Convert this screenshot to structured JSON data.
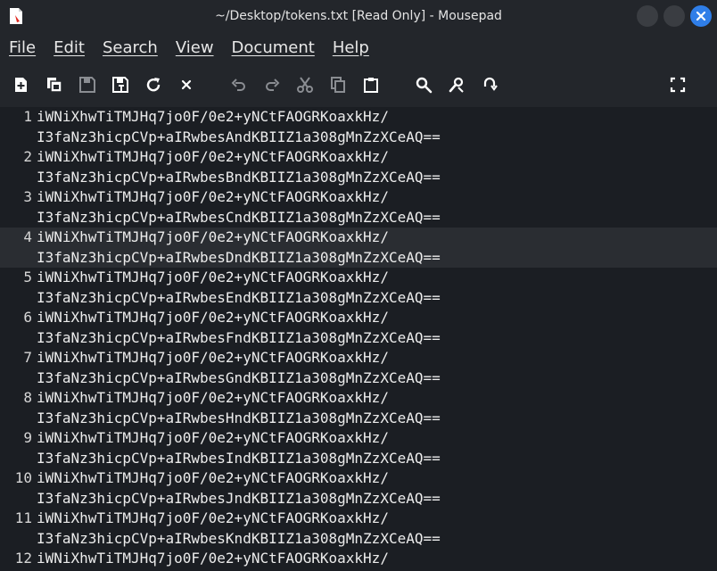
{
  "window": {
    "title": "~/Desktop/tokens.txt [Read Only] - Mousepad"
  },
  "menu": [
    {
      "id": "file",
      "label": "File"
    },
    {
      "id": "edit",
      "label": "Edit"
    },
    {
      "id": "search",
      "label": "Search"
    },
    {
      "id": "view",
      "label": "View"
    },
    {
      "id": "document",
      "label": "Document"
    },
    {
      "id": "help",
      "label": "Help"
    }
  ],
  "toolbar": {
    "icons": [
      "new-document-icon",
      "new-window-icon",
      "save-icon",
      "save-as-icon",
      "reload-icon",
      "close-tab-icon",
      "undo-icon",
      "redo-icon",
      "cut-icon",
      "copy-icon",
      "paste-icon",
      "find-icon",
      "find-replace-icon",
      "go-to-icon",
      "fullscreen-icon"
    ]
  },
  "editor": {
    "current_line": 4,
    "lines": [
      {
        "number": "1",
        "part1": "iWNiXhwTiTMJHq7jo0F/0e2+yNCtFAOGRKoaxkHz/",
        "part2": "I3faNz3hicpCVp+aIRwbesAndKBIIZ1a308gMnZzXCeAQ=="
      },
      {
        "number": "2",
        "part1": "iWNiXhwTiTMJHq7jo0F/0e2+yNCtFAOGRKoaxkHz/",
        "part2": "I3faNz3hicpCVp+aIRwbesBndKBIIZ1a308gMnZzXCeAQ=="
      },
      {
        "number": "3",
        "part1": "iWNiXhwTiTMJHq7jo0F/0e2+yNCtFAOGRKoaxkHz/",
        "part2": "I3faNz3hicpCVp+aIRwbesCndKBIIZ1a308gMnZzXCeAQ=="
      },
      {
        "number": "4",
        "part1": "iWNiXhwTiTMJHq7jo0F/0e2+yNCtFAOGRKoaxkHz/",
        "part2": "I3faNz3hicpCVp+aIRwbesDndKBIIZ1a308gMnZzXCeAQ=="
      },
      {
        "number": "5",
        "part1": "iWNiXhwTiTMJHq7jo0F/0e2+yNCtFAOGRKoaxkHz/",
        "part2": "I3faNz3hicpCVp+aIRwbesEndKBIIZ1a308gMnZzXCeAQ=="
      },
      {
        "number": "6",
        "part1": "iWNiXhwTiTMJHq7jo0F/0e2+yNCtFAOGRKoaxkHz/",
        "part2": "I3faNz3hicpCVp+aIRwbesFndKBIIZ1a308gMnZzXCeAQ=="
      },
      {
        "number": "7",
        "part1": "iWNiXhwTiTMJHq7jo0F/0e2+yNCtFAOGRKoaxkHz/",
        "part2": "I3faNz3hicpCVp+aIRwbesGndKBIIZ1a308gMnZzXCeAQ=="
      },
      {
        "number": "8",
        "part1": "iWNiXhwTiTMJHq7jo0F/0e2+yNCtFAOGRKoaxkHz/",
        "part2": "I3faNz3hicpCVp+aIRwbesHndKBIIZ1a308gMnZzXCeAQ=="
      },
      {
        "number": "9",
        "part1": "iWNiXhwTiTMJHq7jo0F/0e2+yNCtFAOGRKoaxkHz/",
        "part2": "I3faNz3hicpCVp+aIRwbesIndKBIIZ1a308gMnZzXCeAQ=="
      },
      {
        "number": "10",
        "part1": "iWNiXhwTiTMJHq7jo0F/0e2+yNCtFAOGRKoaxkHz/",
        "part2": "I3faNz3hicpCVp+aIRwbesJndKBIIZ1a308gMnZzXCeAQ=="
      },
      {
        "number": "11",
        "part1": "iWNiXhwTiTMJHq7jo0F/0e2+yNCtFAOGRKoaxkHz/",
        "part2": "I3faNz3hicpCVp+aIRwbesKndKBIIZ1a308gMnZzXCeAQ=="
      },
      {
        "number": "12",
        "part1": "iWNiXhwTiTMJHq7jo0F/0e2+yNCtFAOGRKoaxkHz/",
        "part2": ""
      }
    ]
  }
}
